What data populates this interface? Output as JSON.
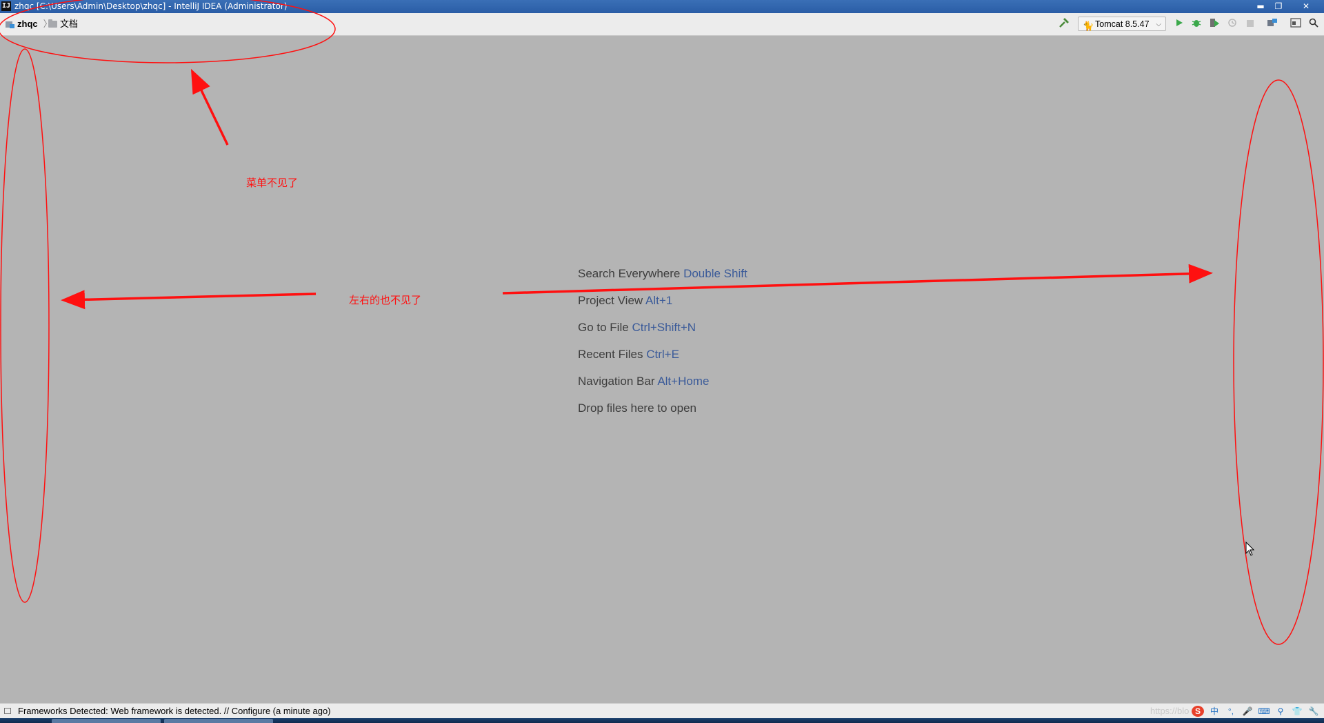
{
  "window": {
    "title": "zhqc [C:\\Users\\Admin\\Desktop\\zhqc] - IntelliJ IDEA (Administrator)",
    "app_icon_glyph": "IJ",
    "minimize_glyph": "▬",
    "restore_glyph": "❐",
    "close_glyph": "✕"
  },
  "navbar": {
    "project_name": "zhqc",
    "folder_name": "文档",
    "separator": "〉",
    "run_config": "Tomcat 8.5.47",
    "run_config_chevron": "⌵",
    "icons": {
      "build": "hammer-icon",
      "run": "run-icon",
      "debug": "debug-icon",
      "coverage": "coverage-icon",
      "profile": "profile-icon",
      "stop": "stop-icon",
      "project_structure": "project-structure-icon",
      "layout": "layout-icon",
      "search": "search-icon"
    }
  },
  "editor_hints": [
    {
      "label": "Search Everywhere",
      "shortcut": "Double Shift"
    },
    {
      "label": "Project View",
      "shortcut": "Alt+1"
    },
    {
      "label": "Go to File",
      "shortcut": "Ctrl+Shift+N"
    },
    {
      "label": "Recent Files",
      "shortcut": "Ctrl+E"
    },
    {
      "label": "Navigation Bar",
      "shortcut": "Alt+Home"
    },
    {
      "label": "Drop files here to open",
      "shortcut": ""
    }
  ],
  "annotations": {
    "menu_missing": "菜单不见了",
    "sides_missing": "左右的也不见了",
    "color": "#ff1010"
  },
  "statusbar": {
    "message": "Frameworks Detected: Web framework is detected. // Configure (a minute ago)",
    "watermark": "https://blo",
    "tray_sogou": "S",
    "tray_lang": "中"
  },
  "colors": {
    "background": "#b4b4b4",
    "shortcut_blue": "#3a5a99",
    "titlebar": "#2a5da6"
  }
}
